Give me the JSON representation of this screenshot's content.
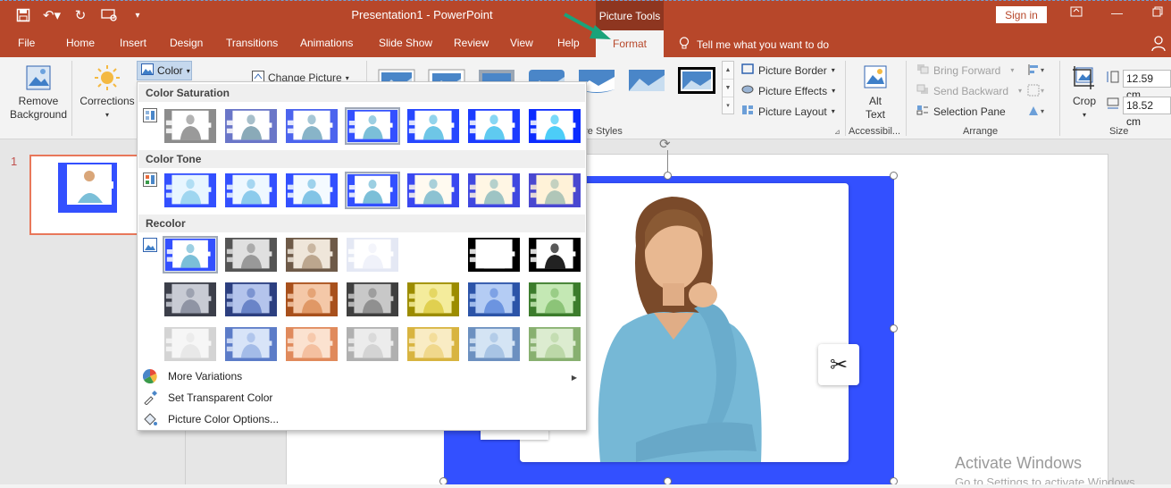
{
  "window": {
    "title": "Presentation1  -  PowerPoint",
    "context_label": "Picture Tools",
    "sign_in": "Sign in"
  },
  "tabs": [
    "File",
    "Home",
    "Insert",
    "Design",
    "Transitions",
    "Animations",
    "Slide Show",
    "Review",
    "View",
    "Help"
  ],
  "active_tab": "Format",
  "tell_me": "Tell me what you want to do",
  "ribbon": {
    "remove_background": "Remove Background",
    "corrections": "Corrections",
    "color": "Color",
    "change_picture": "Change Picture",
    "picture_styles_label": "ure Styles",
    "picture_border": "Picture Border",
    "picture_effects": "Picture Effects",
    "picture_layout": "Picture Layout",
    "alt_text": "Alt Text",
    "accessibility_label": "Accessibil...",
    "bring_forward": "Bring Forward",
    "send_backward": "Send Backward",
    "selection_pane": "Selection Pane",
    "arrange_label": "Arrange",
    "crop": "Crop",
    "size_label": "Size",
    "height_value": "12.59 cm",
    "width_value": "18.52 cm"
  },
  "thumbnails": {
    "slide_number": "1"
  },
  "color_menu": {
    "saturation_title": "Color Saturation",
    "tone_title": "Color Tone",
    "recolor_title": "Recolor",
    "saturation_swatches": [
      {
        "bg": "#8c8c8c",
        "body": "#9a9a9a"
      },
      {
        "bg": "#6a76c8",
        "body": "#8aaab8"
      },
      {
        "bg": "#4c64ee",
        "body": "#88b4c8"
      },
      {
        "bg": "#3350ff",
        "body": "#7bbfd8"
      },
      {
        "bg": "#2748ff",
        "body": "#6ec6e6"
      },
      {
        "bg": "#1c3cff",
        "body": "#5fcaf0"
      },
      {
        "bg": "#0c2cff",
        "body": "#4ccdf8"
      }
    ],
    "tone_swatches": [
      {
        "bg": "#3350ff",
        "body": "#9fd6f0",
        "tint": "#e8f6ff"
      },
      {
        "bg": "#3350ff",
        "body": "#8ccbec",
        "tint": "#eef8ff"
      },
      {
        "bg": "#3350ff",
        "body": "#82c4e6",
        "tint": "#f4faff"
      },
      {
        "bg": "#3350ff",
        "body": "#7bbfd8",
        "tint": "#ffffff"
      },
      {
        "bg": "#3a48f0",
        "body": "#8cc2d2",
        "tint": "#fffaf0"
      },
      {
        "bg": "#4048e0",
        "body": "#9ec4c4",
        "tint": "#fff6e4"
      },
      {
        "bg": "#4a48d0",
        "body": "#b0c6b8",
        "tint": "#fff2d8"
      }
    ],
    "recolor_swatches": [
      {
        "bg": "#3350ff",
        "body": "#7bbfd8",
        "tint": "#ffffff"
      },
      {
        "bg": "#555555",
        "body": "#999999",
        "tint": "#e0e0e0"
      },
      {
        "bg": "#6e5a48",
        "body": "#bca68e",
        "tint": "#efe6da"
      },
      {
        "bg": "#e4e8f4",
        "body": "#f0f2fa",
        "tint": "#ffffff"
      },
      {
        "bg": "#ffffff",
        "body": "#ffffff",
        "tint": "#ffffff"
      },
      {
        "bg": "#000000",
        "body": "#ffffff",
        "tint": "#ffffff"
      },
      {
        "bg": "#000000",
        "body": "#222222",
        "tint": "#ffffff"
      },
      {
        "bg": "#3c3f4a",
        "body": "#8f94a4",
        "tint": "#c8cbd4"
      },
      {
        "bg": "#2c3f80",
        "body": "#6a84c8",
        "tint": "#b4c4ec"
      },
      {
        "bg": "#a8501c",
        "body": "#e09866",
        "tint": "#f4c8a8"
      },
      {
        "bg": "#404040",
        "body": "#909090",
        "tint": "#c8c8c8"
      },
      {
        "bg": "#9c8c00",
        "body": "#e0d050",
        "tint": "#f4ec9c"
      },
      {
        "bg": "#2c54a8",
        "body": "#6c94e0",
        "tint": "#b4ccf4"
      },
      {
        "bg": "#3c7c2c",
        "body": "#8cc478",
        "tint": "#c4e8b4"
      },
      {
        "bg": "#d4d4d4",
        "body": "#e8e8e8",
        "tint": "#f6f6f6"
      },
      {
        "bg": "#5c7cc8",
        "body": "#a4bce8",
        "tint": "#d8e4f8"
      },
      {
        "bg": "#e08a5c",
        "body": "#f4c0a0",
        "tint": "#fbe2d0"
      },
      {
        "bg": "#b0b0b0",
        "body": "#d4d4d4",
        "tint": "#ececec"
      },
      {
        "bg": "#d8b440",
        "body": "#f0d88c",
        "tint": "#f9ecc4"
      },
      {
        "bg": "#6c90c0",
        "body": "#a8c4e4",
        "tint": "#d4e4f4"
      },
      {
        "bg": "#88b070",
        "body": "#bcd8a8",
        "tint": "#dcecd0"
      }
    ],
    "more_variations": "More Variations",
    "set_transparent": "Set Transparent Color",
    "picture_color_options": "Picture Color Options..."
  },
  "watermark": {
    "line1": "Activate Windows",
    "line2": "Go to Settings to activate Windows."
  },
  "colors": {
    "accent": "#b7472a",
    "picture_bg": "#3350ff"
  }
}
